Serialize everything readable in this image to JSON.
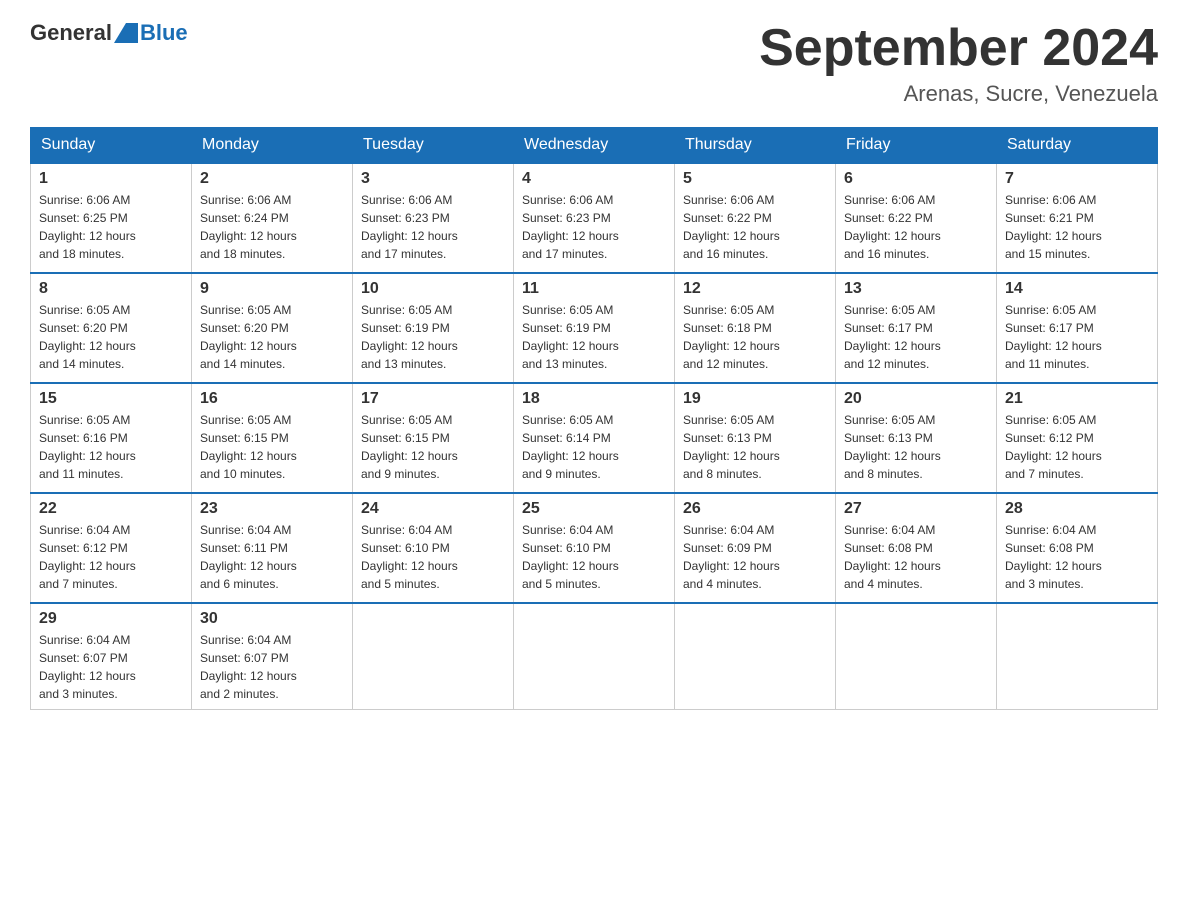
{
  "header": {
    "logo_general": "General",
    "logo_blue": "Blue",
    "month_title": "September 2024",
    "subtitle": "Arenas, Sucre, Venezuela"
  },
  "weekdays": [
    "Sunday",
    "Monday",
    "Tuesday",
    "Wednesday",
    "Thursday",
    "Friday",
    "Saturday"
  ],
  "weeks": [
    [
      {
        "day": "1",
        "sunrise": "6:06 AM",
        "sunset": "6:25 PM",
        "daylight": "12 hours and 18 minutes."
      },
      {
        "day": "2",
        "sunrise": "6:06 AM",
        "sunset": "6:24 PM",
        "daylight": "12 hours and 18 minutes."
      },
      {
        "day": "3",
        "sunrise": "6:06 AM",
        "sunset": "6:23 PM",
        "daylight": "12 hours and 17 minutes."
      },
      {
        "day": "4",
        "sunrise": "6:06 AM",
        "sunset": "6:23 PM",
        "daylight": "12 hours and 17 minutes."
      },
      {
        "day": "5",
        "sunrise": "6:06 AM",
        "sunset": "6:22 PM",
        "daylight": "12 hours and 16 minutes."
      },
      {
        "day": "6",
        "sunrise": "6:06 AM",
        "sunset": "6:22 PM",
        "daylight": "12 hours and 16 minutes."
      },
      {
        "day": "7",
        "sunrise": "6:06 AM",
        "sunset": "6:21 PM",
        "daylight": "12 hours and 15 minutes."
      }
    ],
    [
      {
        "day": "8",
        "sunrise": "6:05 AM",
        "sunset": "6:20 PM",
        "daylight": "12 hours and 14 minutes."
      },
      {
        "day": "9",
        "sunrise": "6:05 AM",
        "sunset": "6:20 PM",
        "daylight": "12 hours and 14 minutes."
      },
      {
        "day": "10",
        "sunrise": "6:05 AM",
        "sunset": "6:19 PM",
        "daylight": "12 hours and 13 minutes."
      },
      {
        "day": "11",
        "sunrise": "6:05 AM",
        "sunset": "6:19 PM",
        "daylight": "12 hours and 13 minutes."
      },
      {
        "day": "12",
        "sunrise": "6:05 AM",
        "sunset": "6:18 PM",
        "daylight": "12 hours and 12 minutes."
      },
      {
        "day": "13",
        "sunrise": "6:05 AM",
        "sunset": "6:17 PM",
        "daylight": "12 hours and 12 minutes."
      },
      {
        "day": "14",
        "sunrise": "6:05 AM",
        "sunset": "6:17 PM",
        "daylight": "12 hours and 11 minutes."
      }
    ],
    [
      {
        "day": "15",
        "sunrise": "6:05 AM",
        "sunset": "6:16 PM",
        "daylight": "12 hours and 11 minutes."
      },
      {
        "day": "16",
        "sunrise": "6:05 AM",
        "sunset": "6:15 PM",
        "daylight": "12 hours and 10 minutes."
      },
      {
        "day": "17",
        "sunrise": "6:05 AM",
        "sunset": "6:15 PM",
        "daylight": "12 hours and 9 minutes."
      },
      {
        "day": "18",
        "sunrise": "6:05 AM",
        "sunset": "6:14 PM",
        "daylight": "12 hours and 9 minutes."
      },
      {
        "day": "19",
        "sunrise": "6:05 AM",
        "sunset": "6:13 PM",
        "daylight": "12 hours and 8 minutes."
      },
      {
        "day": "20",
        "sunrise": "6:05 AM",
        "sunset": "6:13 PM",
        "daylight": "12 hours and 8 minutes."
      },
      {
        "day": "21",
        "sunrise": "6:05 AM",
        "sunset": "6:12 PM",
        "daylight": "12 hours and 7 minutes."
      }
    ],
    [
      {
        "day": "22",
        "sunrise": "6:04 AM",
        "sunset": "6:12 PM",
        "daylight": "12 hours and 7 minutes."
      },
      {
        "day": "23",
        "sunrise": "6:04 AM",
        "sunset": "6:11 PM",
        "daylight": "12 hours and 6 minutes."
      },
      {
        "day": "24",
        "sunrise": "6:04 AM",
        "sunset": "6:10 PM",
        "daylight": "12 hours and 5 minutes."
      },
      {
        "day": "25",
        "sunrise": "6:04 AM",
        "sunset": "6:10 PM",
        "daylight": "12 hours and 5 minutes."
      },
      {
        "day": "26",
        "sunrise": "6:04 AM",
        "sunset": "6:09 PM",
        "daylight": "12 hours and 4 minutes."
      },
      {
        "day": "27",
        "sunrise": "6:04 AM",
        "sunset": "6:08 PM",
        "daylight": "12 hours and 4 minutes."
      },
      {
        "day": "28",
        "sunrise": "6:04 AM",
        "sunset": "6:08 PM",
        "daylight": "12 hours and 3 minutes."
      }
    ],
    [
      {
        "day": "29",
        "sunrise": "6:04 AM",
        "sunset": "6:07 PM",
        "daylight": "12 hours and 3 minutes."
      },
      {
        "day": "30",
        "sunrise": "6:04 AM",
        "sunset": "6:07 PM",
        "daylight": "12 hours and 2 minutes."
      },
      null,
      null,
      null,
      null,
      null
    ]
  ],
  "labels": {
    "sunrise": "Sunrise:",
    "sunset": "Sunset:",
    "daylight": "Daylight:"
  }
}
